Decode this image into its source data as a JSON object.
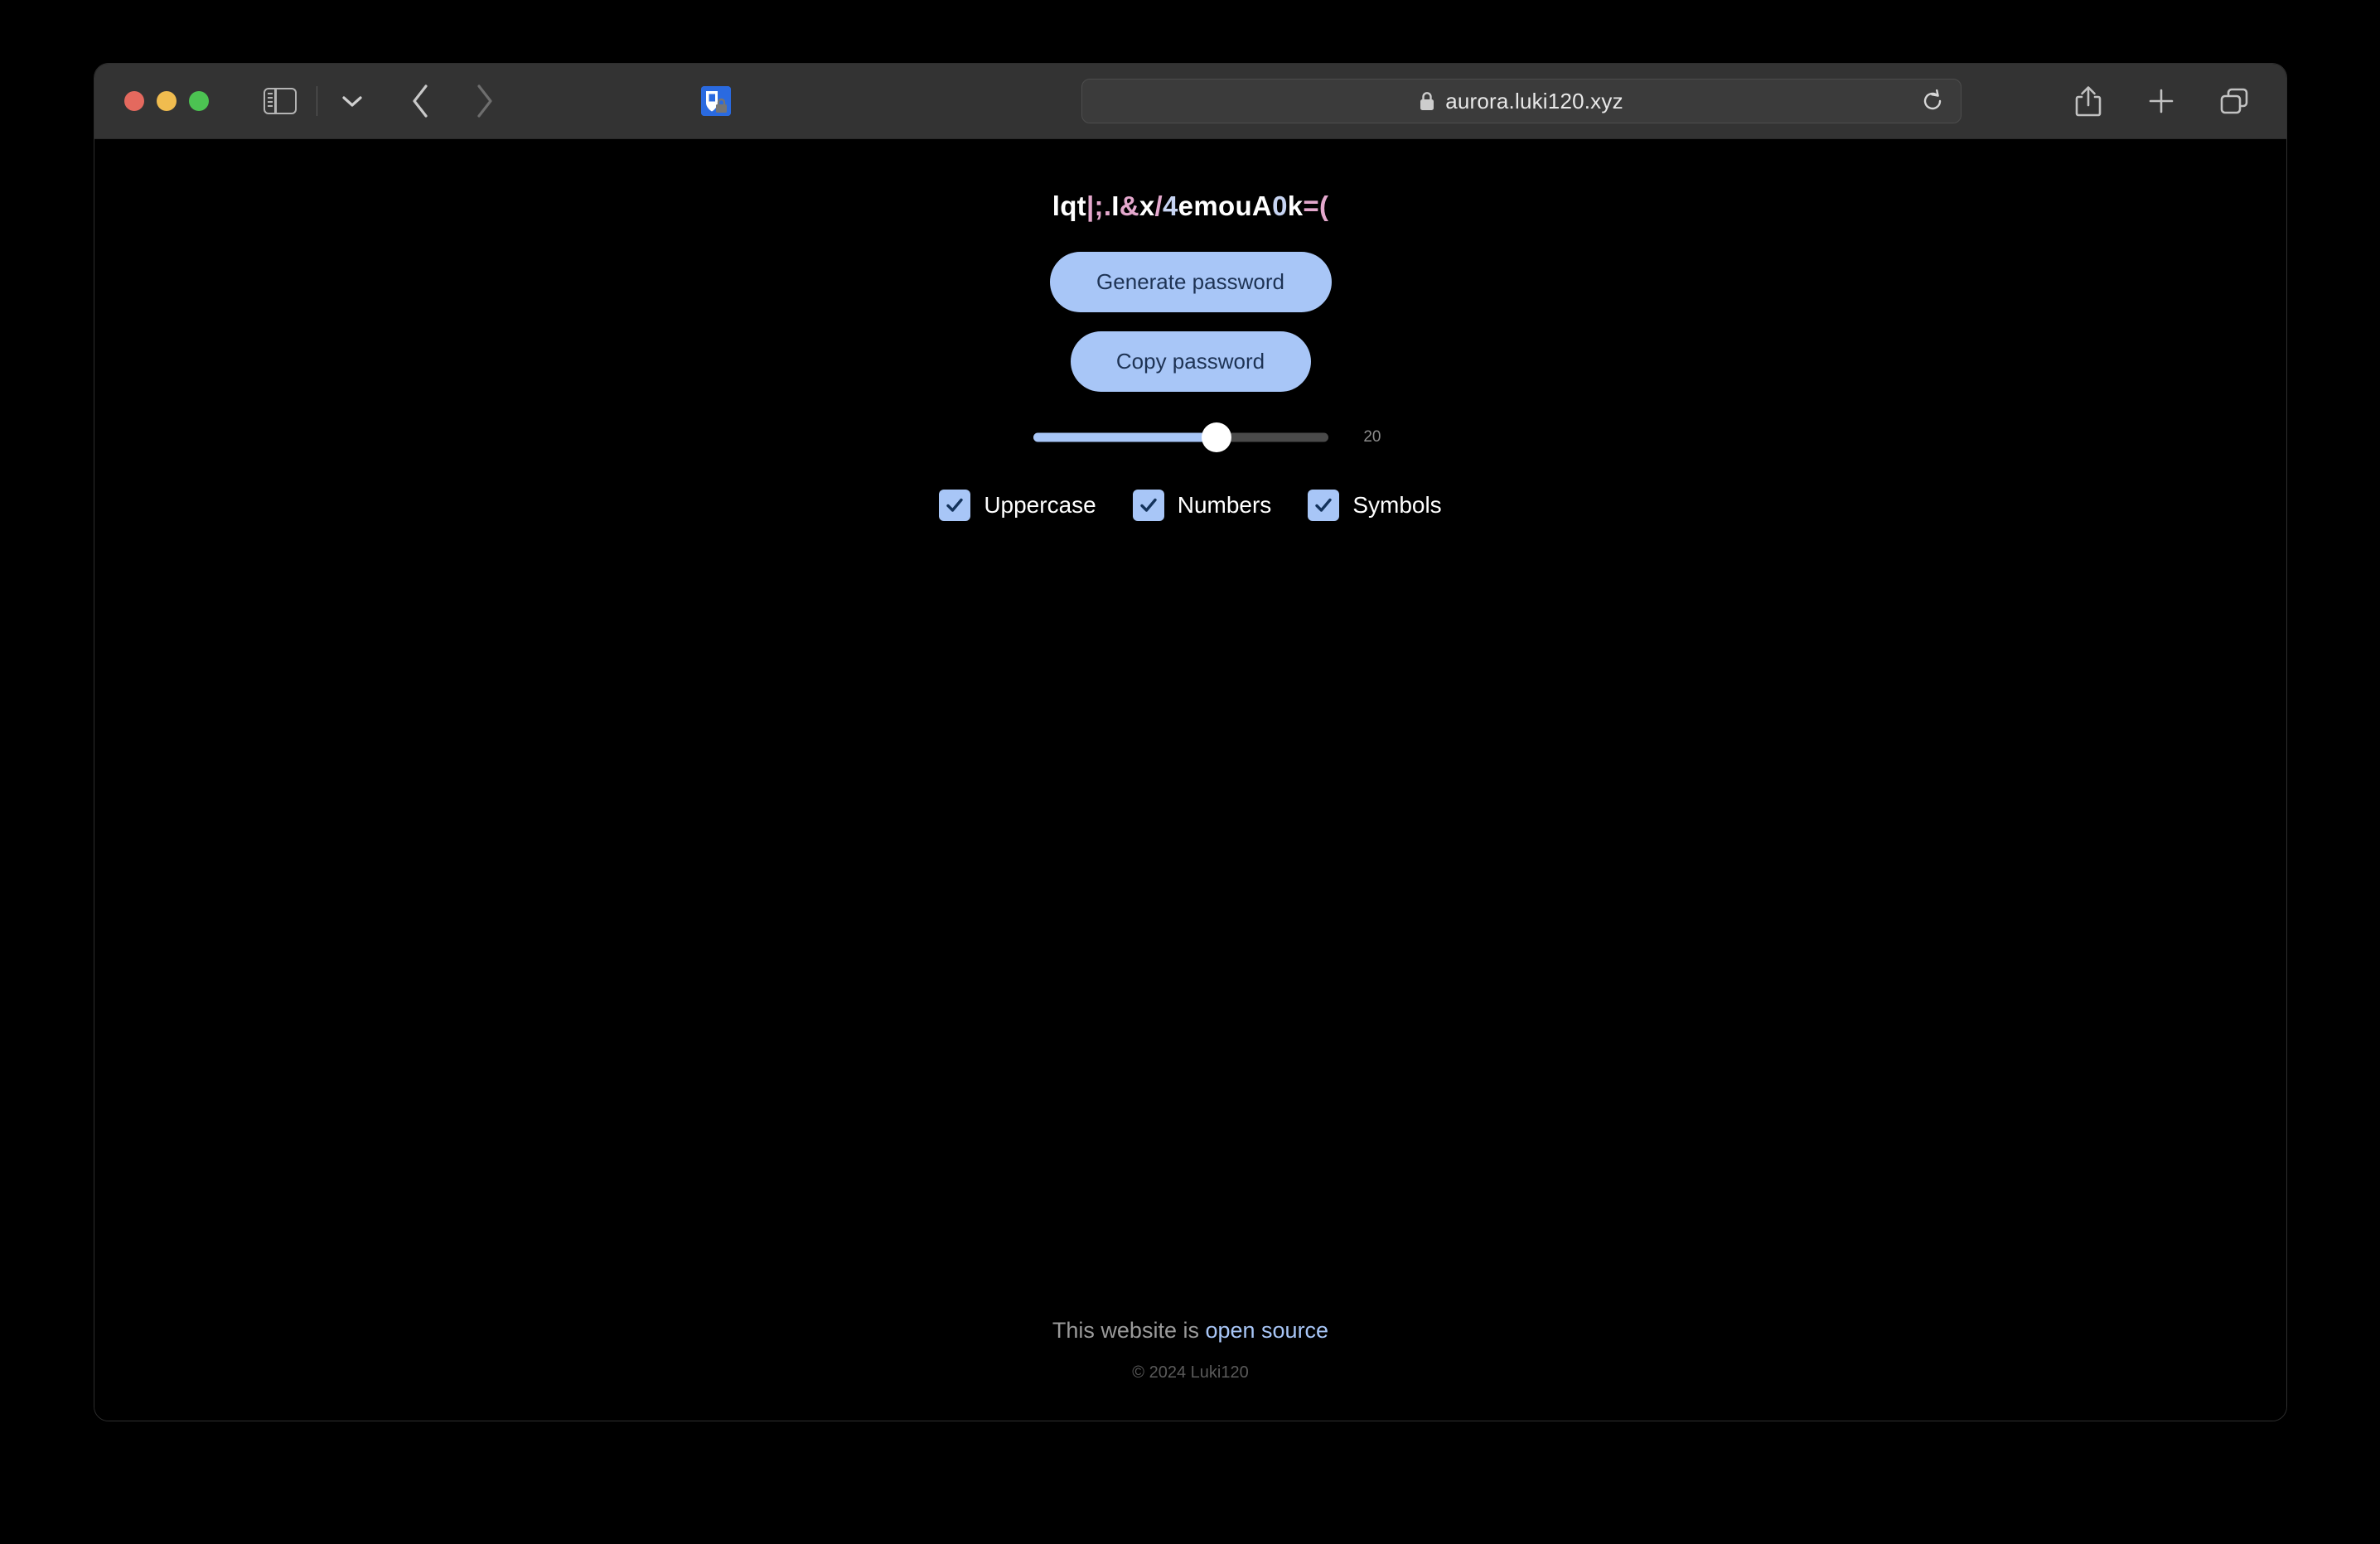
{
  "browser": {
    "traffic_lights": [
      "close",
      "minimize",
      "maximize"
    ],
    "sidebar_tooltip": "Sidebar",
    "tab_chevron": "Tab Overview",
    "back_label": "Back",
    "forward_label": "Forward",
    "favicon_name": "shield-lock-favicon",
    "url": "aurora.luki120.xyz",
    "lock_label": "Secure",
    "reload_label": "Reload",
    "share_label": "Share",
    "new_tab_label": "New Tab",
    "tab_overview_label": "Tab Overview"
  },
  "password": {
    "value": "lqt|;.I&x/4emouA0k=(",
    "characters": [
      {
        "c": "l",
        "kind": "letter"
      },
      {
        "c": "q",
        "kind": "letter"
      },
      {
        "c": "t",
        "kind": "letter"
      },
      {
        "c": "|",
        "kind": "symbol"
      },
      {
        "c": ";",
        "kind": "symbol"
      },
      {
        "c": ".",
        "kind": "symbol"
      },
      {
        "c": "I",
        "kind": "letter"
      },
      {
        "c": "&",
        "kind": "symbol"
      },
      {
        "c": "x",
        "kind": "letter"
      },
      {
        "c": "/",
        "kind": "symbol"
      },
      {
        "c": "4",
        "kind": "number"
      },
      {
        "c": "e",
        "kind": "letter"
      },
      {
        "c": "m",
        "kind": "letter"
      },
      {
        "c": "o",
        "kind": "letter"
      },
      {
        "c": "u",
        "kind": "letter"
      },
      {
        "c": "A",
        "kind": "letter"
      },
      {
        "c": "0",
        "kind": "number"
      },
      {
        "c": "k",
        "kind": "letter"
      },
      {
        "c": "=",
        "kind": "symbol"
      },
      {
        "c": "(",
        "kind": "symbol"
      }
    ]
  },
  "actions": {
    "generate_label": "Generate password",
    "copy_label": "Copy password"
  },
  "length_slider": {
    "value": "20",
    "min": 8,
    "max": 28,
    "percent": 62
  },
  "options": [
    {
      "label": "Uppercase",
      "checked": true
    },
    {
      "label": "Numbers",
      "checked": true
    },
    {
      "label": "Symbols",
      "checked": true
    }
  ],
  "footer": {
    "prefix": "This website is ",
    "link_label": "open source",
    "copyright": "© 2024 Luki120"
  },
  "colors": {
    "accent": "#a8c6f7",
    "accent_text": "#1e3354",
    "page_bg": "#000000",
    "toolbar_bg": "#333333",
    "symbol_char": "#e4a8cd",
    "number_char": "#c7d4f2",
    "letter_char": "#ffffff",
    "footer_text": "#9a9a9a",
    "copyright_text": "#5a5a5a"
  }
}
